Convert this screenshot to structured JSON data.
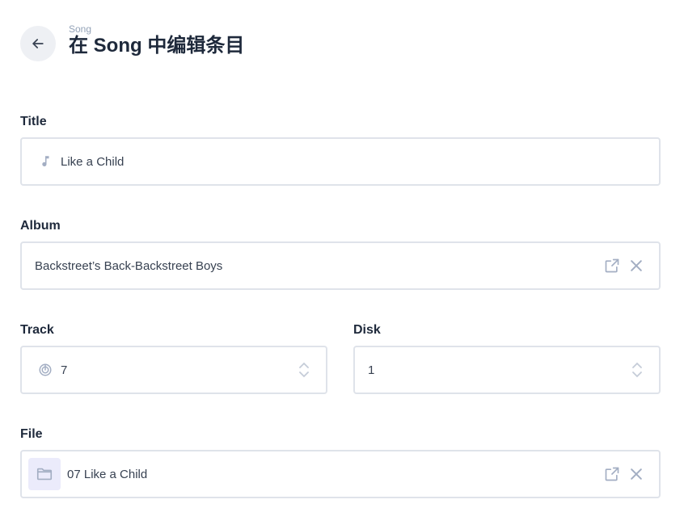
{
  "header": {
    "breadcrumb": "Song",
    "title": "在 Song 中编辑条目"
  },
  "fields": {
    "title": {
      "label": "Title",
      "value": "Like a Child"
    },
    "album": {
      "label": "Album",
      "value": "Backstreet’s Back-Backstreet Boys"
    },
    "track": {
      "label": "Track",
      "value": "7"
    },
    "disk": {
      "label": "Disk",
      "value": "1"
    },
    "file": {
      "label": "File",
      "value": "07 Like a Child"
    }
  },
  "icons": {
    "back": "arrow-left-icon",
    "title": "music-note-icon",
    "track": "radar-icon",
    "file": "folder-icon",
    "open": "external-link-icon",
    "clear": "close-icon"
  },
  "colors": {
    "icon": "#a3aec3",
    "border": "#dfe3ea",
    "folder_bg": "#ebebfb",
    "text": "#1e293b"
  }
}
